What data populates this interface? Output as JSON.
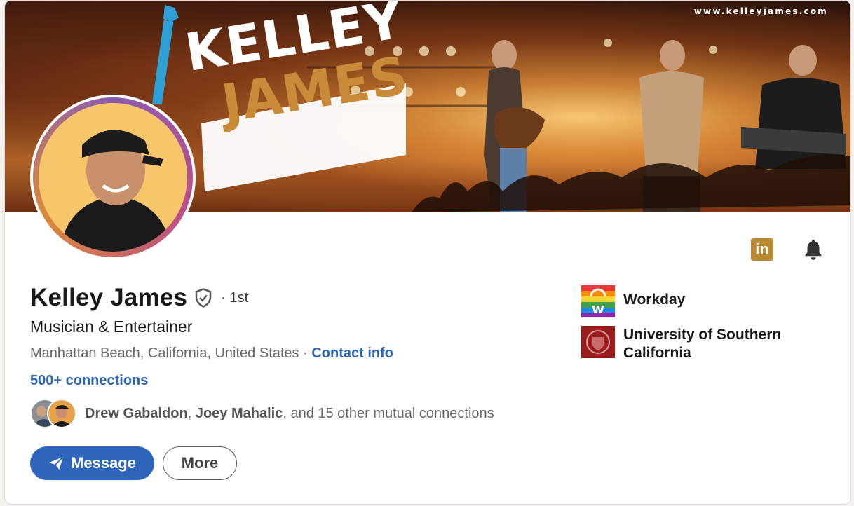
{
  "banner": {
    "url_text": "www.kelleyjames.com",
    "logo_line1": "KELLEY",
    "logo_line2": "JAMES"
  },
  "profile": {
    "name": "Kelley James",
    "degree": "· 1st",
    "headline": "Musician & Entertainer",
    "location": "Manhattan Beach, California, United States",
    "separator": " · ",
    "contact_info": "Contact info",
    "connections": "500+ connections"
  },
  "mutual": {
    "name1": "Drew Gabaldon",
    "comma": ", ",
    "name2": "Joey Mahalic",
    "rest": ", and 15 other mutual connections"
  },
  "actions": {
    "message_label": "Message",
    "more_label": "More"
  },
  "orgs": [
    {
      "name": "Workday",
      "logo_icon": "workday-pride-logo-icon"
    },
    {
      "name": "University of Southern California",
      "logo_icon": "usc-seal-icon"
    }
  ],
  "icons": {
    "linkedin": "linkedin-icon",
    "bell": "bell-icon",
    "verified": "verified-shield-icon",
    "send": "paper-plane-icon"
  },
  "colors": {
    "link_blue": "#2d64bc",
    "linkedin_gold": "#b98a2f",
    "text_dark": "#191919",
    "text_muted": "#666666"
  }
}
